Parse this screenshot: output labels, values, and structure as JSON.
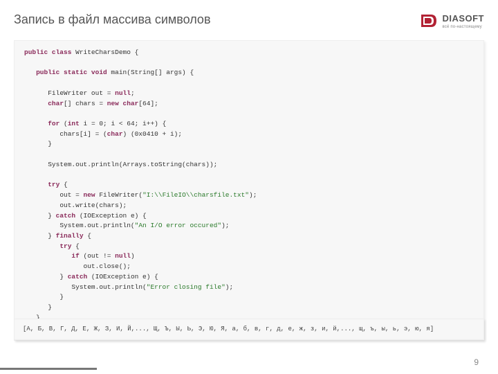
{
  "header": {
    "title": "Запись в файл массива символов"
  },
  "brand": {
    "name": "DIASOFT",
    "tagline": "всё по-настоящему",
    "accent_color": "#b22234"
  },
  "code": {
    "lines": [
      {
        "indent": 0,
        "tokens": [
          {
            "t": "public class",
            "c": "kw"
          },
          {
            "t": " WriteCharsDemo {"
          }
        ]
      },
      {
        "indent": 0,
        "tokens": [
          {
            "t": ""
          }
        ]
      },
      {
        "indent": 1,
        "tokens": [
          {
            "t": "public static void",
            "c": "kw"
          },
          {
            "t": " main(String[] args) {"
          }
        ]
      },
      {
        "indent": 0,
        "tokens": [
          {
            "t": ""
          }
        ]
      },
      {
        "indent": 2,
        "tokens": [
          {
            "t": "FileWriter out = "
          },
          {
            "t": "null",
            "c": "kw"
          },
          {
            "t": ";"
          }
        ]
      },
      {
        "indent": 2,
        "tokens": [
          {
            "t": "char",
            "c": "kw"
          },
          {
            "t": "[] chars = "
          },
          {
            "t": "new char",
            "c": "kw"
          },
          {
            "t": "[64];"
          }
        ]
      },
      {
        "indent": 0,
        "tokens": [
          {
            "t": ""
          }
        ]
      },
      {
        "indent": 2,
        "tokens": [
          {
            "t": "for",
            "c": "kw"
          },
          {
            "t": " ("
          },
          {
            "t": "int",
            "c": "kw"
          },
          {
            "t": " i = 0; i < 64; i++) {"
          }
        ]
      },
      {
        "indent": 3,
        "tokens": [
          {
            "t": "chars[i] = ("
          },
          {
            "t": "char",
            "c": "kw"
          },
          {
            "t": ") (0x0410 + i);"
          }
        ]
      },
      {
        "indent": 2,
        "tokens": [
          {
            "t": "}"
          }
        ]
      },
      {
        "indent": 0,
        "tokens": [
          {
            "t": ""
          }
        ]
      },
      {
        "indent": 2,
        "tokens": [
          {
            "t": "System.out.println(Arrays.toString(chars));"
          }
        ]
      },
      {
        "indent": 0,
        "tokens": [
          {
            "t": ""
          }
        ]
      },
      {
        "indent": 2,
        "tokens": [
          {
            "t": "try",
            "c": "kw"
          },
          {
            "t": " {"
          }
        ]
      },
      {
        "indent": 3,
        "tokens": [
          {
            "t": "out = "
          },
          {
            "t": "new",
            "c": "kw"
          },
          {
            "t": " FileWriter("
          },
          {
            "t": "\"I:\\\\FileIO\\\\charsfile.txt\"",
            "c": "str"
          },
          {
            "t": ");"
          }
        ]
      },
      {
        "indent": 3,
        "tokens": [
          {
            "t": "out.write(chars);"
          }
        ]
      },
      {
        "indent": 2,
        "tokens": [
          {
            "t": "} "
          },
          {
            "t": "catch",
            "c": "kw"
          },
          {
            "t": " (IOException e) {"
          }
        ]
      },
      {
        "indent": 3,
        "tokens": [
          {
            "t": "System.out.println("
          },
          {
            "t": "\"An I/O error occured\"",
            "c": "str"
          },
          {
            "t": ");"
          }
        ]
      },
      {
        "indent": 2,
        "tokens": [
          {
            "t": "} "
          },
          {
            "t": "finally",
            "c": "kw"
          },
          {
            "t": " {"
          }
        ]
      },
      {
        "indent": 3,
        "tokens": [
          {
            "t": "try",
            "c": "kw"
          },
          {
            "t": " {"
          }
        ]
      },
      {
        "indent": 4,
        "tokens": [
          {
            "t": "if",
            "c": "kw"
          },
          {
            "t": " (out != "
          },
          {
            "t": "null",
            "c": "kw"
          },
          {
            "t": ")"
          }
        ]
      },
      {
        "indent": 5,
        "tokens": [
          {
            "t": "out.close();"
          }
        ]
      },
      {
        "indent": 3,
        "tokens": [
          {
            "t": "} "
          },
          {
            "t": "catch",
            "c": "kw"
          },
          {
            "t": " (IOException e) {"
          }
        ]
      },
      {
        "indent": 4,
        "tokens": [
          {
            "t": "System.out.println("
          },
          {
            "t": "\"Error closing file\"",
            "c": "str"
          },
          {
            "t": ");"
          }
        ]
      },
      {
        "indent": 3,
        "tokens": [
          {
            "t": "}"
          }
        ]
      },
      {
        "indent": 2,
        "tokens": [
          {
            "t": "}"
          }
        ]
      },
      {
        "indent": 1,
        "tokens": [
          {
            "t": "}"
          }
        ]
      },
      {
        "indent": 0,
        "tokens": [
          {
            "t": "}"
          }
        ]
      }
    ]
  },
  "output_box": {
    "text": "[А, Б, В, Г, Д, Е, Ж, З, И, Й,..., Щ, Ъ, Ы, Ь, Э, Ю, Я, а, б, в, г, д, е, ж, з, и, й,..., щ, ъ, ы, ь, э, ю, я]"
  },
  "page_number": "9"
}
